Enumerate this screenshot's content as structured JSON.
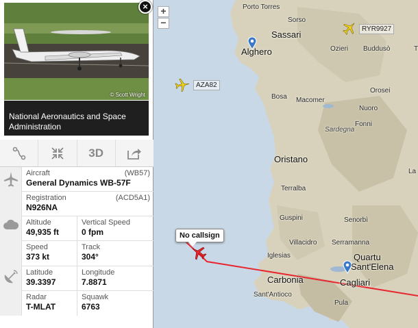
{
  "photo": {
    "credit": "© Scott Wright"
  },
  "airline": "National Aeronautics and Space Administration",
  "toolbar": {
    "threed_label": "3D"
  },
  "aircraft": {
    "label": "Aircraft",
    "code": "(WB57)",
    "value": "General Dynamics WB-57F"
  },
  "registration": {
    "label": "Registration",
    "code": "(ACD5A1)",
    "value": "N926NA"
  },
  "altitude": {
    "label": "Altitude",
    "value": "49,935 ft"
  },
  "vertical_speed": {
    "label": "Vertical Speed",
    "value": "0 fpm"
  },
  "speed": {
    "label": "Speed",
    "value": "373 kt"
  },
  "track": {
    "label": "Track",
    "value": "304°"
  },
  "latitude": {
    "label": "Latitude",
    "value": "39.3397"
  },
  "longitude": {
    "label": "Longitude",
    "value": "7.8871"
  },
  "radar": {
    "label": "Radar",
    "value": "T-MLAT"
  },
  "squawk": {
    "label": "Squawk",
    "value": "6763"
  },
  "map": {
    "zoom_in": "+",
    "zoom_out": "−",
    "flights": {
      "ryr": "RYR9927",
      "aza": "AZA82"
    },
    "selected_label": "No callsign",
    "places": {
      "porto_torres": "Porto Torres",
      "sorso": "Sorso",
      "sassari": "Sassari",
      "alghero": "Alghero",
      "ozieri": "Ozieri",
      "budduso": "Buddusò",
      "olbia_t": "T",
      "bosa": "Bosa",
      "macomer": "Macomer",
      "orosei": "Orosei",
      "sardegna": "Sardegna",
      "nuoro": "Nuoro",
      "fonni": "Fonni",
      "oristano": "Oristano",
      "terralba": "Terralba",
      "lanusei": "La",
      "senorbi": "Senorbì",
      "guspini": "Guspini",
      "villacidro": "Villacidro",
      "serramanna": "Serramanna",
      "iglesias": "Iglesias",
      "quartu": "Quartu",
      "santelena": "Sant'Elena",
      "carbonia": "Carbonia",
      "cagliari": "Cagliari",
      "santantioco": "Sant'Antioco",
      "pula": "Pula"
    }
  }
}
